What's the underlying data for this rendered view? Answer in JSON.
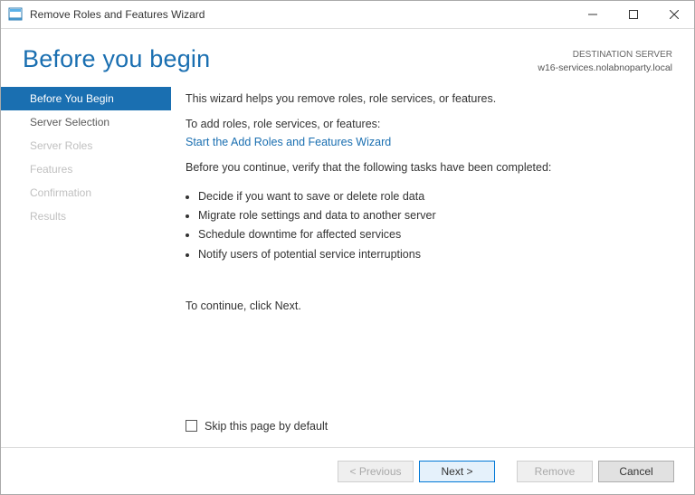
{
  "window": {
    "title": "Remove Roles and Features Wizard"
  },
  "header": {
    "page_title": "Before you begin",
    "dest_label": "DESTINATION SERVER",
    "dest_value": "w16-services.nolabnoparty.local"
  },
  "sidebar": {
    "steps": [
      {
        "label": "Before You Begin",
        "state": "active"
      },
      {
        "label": "Server Selection",
        "state": "enabled"
      },
      {
        "label": "Server Roles",
        "state": "disabled"
      },
      {
        "label": "Features",
        "state": "disabled"
      },
      {
        "label": "Confirmation",
        "state": "disabled"
      },
      {
        "label": "Results",
        "state": "disabled"
      }
    ]
  },
  "main": {
    "intro": "This wizard helps you remove roles, role services, or features.",
    "add_prompt": "To add roles, role services, or features:",
    "add_link": "Start the Add Roles and Features Wizard",
    "verify_prompt": "Before you continue, verify that the following tasks have been completed:",
    "bullets": [
      "Decide if you want to save or delete role data",
      "Migrate role settings and data to another server",
      "Schedule downtime for affected services",
      "Notify users of potential service interruptions"
    ],
    "continue_hint": "To continue, click Next.",
    "skip_label": "Skip this page by default",
    "skip_checked": false
  },
  "footer": {
    "previous": "< Previous",
    "next": "Next >",
    "remove": "Remove",
    "cancel": "Cancel"
  }
}
